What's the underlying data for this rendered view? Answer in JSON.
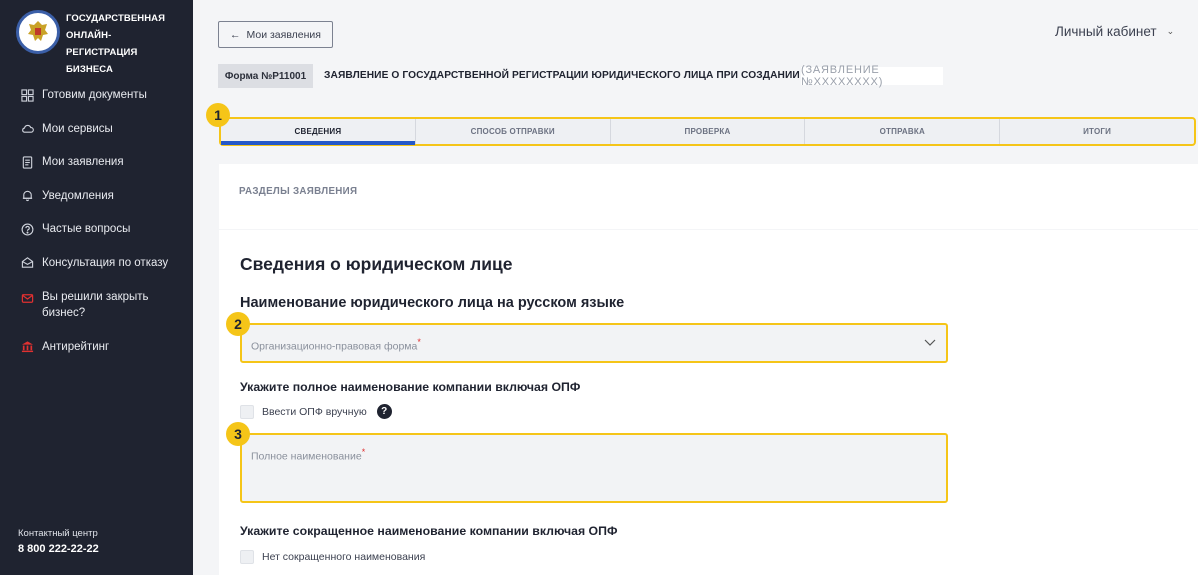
{
  "sidebar": {
    "logo_text": "ГОСУДАРСТВЕННАЯ ОНЛАЙН-РЕГИСТРАЦИЯ БИЗНЕСА",
    "items": [
      {
        "label": "Готовим документы",
        "icon": "grid-icon"
      },
      {
        "label": "Мои сервисы",
        "icon": "cloud-icon"
      },
      {
        "label": "Мои заявления",
        "icon": "document-icon"
      },
      {
        "label": "Уведомления",
        "icon": "bell-icon"
      },
      {
        "label": "Частые вопросы",
        "icon": "question-circle-icon"
      },
      {
        "label": "Консультация по отказу",
        "icon": "chat-icon"
      },
      {
        "label": "Вы решили закрыть бизнес?",
        "icon": "mail-icon"
      },
      {
        "label": "Антирейтинг",
        "icon": "building-icon"
      }
    ],
    "contact_label": "Контактный центр",
    "contact_phone": "8 800 222-22-22"
  },
  "header": {
    "back_label": "Мои заявления",
    "account_label": "Личный кабинет"
  },
  "form": {
    "badge": "Форма №Р11001",
    "title": "ЗАЯВЛЕНИЕ О ГОСУДАРСТВЕННОЙ РЕГИСТРАЦИИ ЮРИДИЧЕСКОГО ЛИЦА ПРИ СОЗДАНИИ",
    "number": "(ЗАЯВЛЕНИЕ №XXXXXXXX)"
  },
  "tabs": [
    {
      "label": "СВЕДЕНИЯ",
      "active": true
    },
    {
      "label": "СПОСОБ ОТПРАВКИ",
      "active": false
    },
    {
      "label": "ПРОВЕРКА",
      "active": false
    },
    {
      "label": "ОТПРАВКА",
      "active": false
    },
    {
      "label": "ИТОГИ",
      "active": false
    }
  ],
  "markers": [
    "1",
    "2",
    "3"
  ],
  "sections_label": "РАЗДЕЛЫ ЗАЯВЛЕНИЯ",
  "content": {
    "heading": "Сведения о юридическом лице",
    "subheading": "Наименование юридического лица на русском языке",
    "opf_placeholder": "Организационно-правовая форма",
    "full_name_heading": "Укажите полное наименование компании включая ОПФ",
    "manual_opf_label": "Ввести ОПФ вручную",
    "help_glyph": "?",
    "full_name_placeholder": "Полное наименование",
    "short_name_heading": "Укажите сокращенное наименование компании включая ОПФ",
    "no_short_name_label": "Нет сокращенного наименования"
  },
  "colors": {
    "sidebar_bg": "#1f2330",
    "highlight": "#f5c518",
    "active_tab": "#2458c8",
    "required": "#e03131"
  }
}
